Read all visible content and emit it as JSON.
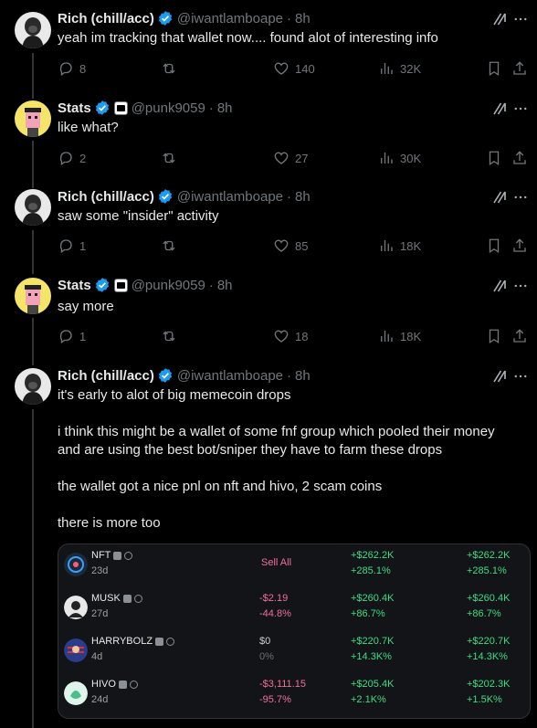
{
  "users": {
    "rich": {
      "name": "Rich (chill/acc)",
      "handle": "@iwantlamboape"
    },
    "stats": {
      "name": "Stats",
      "handle": "@punk9059"
    }
  },
  "tweets": [
    {
      "time": "8h",
      "text": "yeah im tracking that wallet now.... found alot of interesting info",
      "replies": "8",
      "reposts": "",
      "likes": "140",
      "views": "32K"
    },
    {
      "time": "8h",
      "text": "like what?",
      "replies": "2",
      "reposts": "",
      "likes": "27",
      "views": "30K"
    },
    {
      "time": "8h",
      "text": "saw some \"insider\" activity",
      "replies": "1",
      "reposts": "",
      "likes": "85",
      "views": "18K"
    },
    {
      "time": "8h",
      "text": "say more",
      "replies": "1",
      "reposts": "",
      "likes": "18",
      "views": "18K"
    },
    {
      "time": "8h",
      "paragraphs": [
        "it's early to alot of big memecoin drops",
        "i think this might be a wallet of some fnf group which pooled their money and are using the best bot/sniper they have to farm these drops",
        "the wallet got a nice pnl on nft and hivo, 2 scam coins",
        "there is more too"
      ]
    }
  ],
  "dot": "·",
  "card": {
    "rows": [
      {
        "token": "NFT",
        "age": "23d",
        "col1": "Sell All",
        "col2a": "+$262.2K",
        "col2b": "+285.1%",
        "col3a": "+$262.2K",
        "col3b": "+285.1%"
      },
      {
        "token": "MUSK",
        "age": "27d",
        "col1a": "-$2.19",
        "col1b": "-44.8%",
        "col2a": "+$260.4K",
        "col2b": "+86.7%",
        "col3a": "+$260.4K",
        "col3b": "+86.7%"
      },
      {
        "token": "HARRYBOLZ",
        "age": "4d",
        "col1a": "$0",
        "col1b": "0%",
        "col2a": "+$220.7K",
        "col2b": "+14.3K%",
        "col3a": "+$220.7K",
        "col3b": "+14.3K%"
      },
      {
        "token": "HIVO",
        "age": "24d",
        "col1a": "-$3,111.15",
        "col1b": "-95.7%",
        "col2a": "+$205.4K",
        "col2b": "+2.1K%",
        "col3a": "+$202.3K",
        "col3b": "+1.5K%"
      }
    ]
  },
  "colors": {
    "background": "#000000",
    "text": "#e7e9ea",
    "muted": "#71767b",
    "verified": "#1d9bf0",
    "gain": "#3ddc84",
    "loss": "#f0719a"
  },
  "icons": [
    "verified-badge-icon",
    "grok-icon",
    "more-icon",
    "reply-icon",
    "repost-icon",
    "like-icon",
    "views-icon",
    "bookmark-icon",
    "share-icon"
  ]
}
